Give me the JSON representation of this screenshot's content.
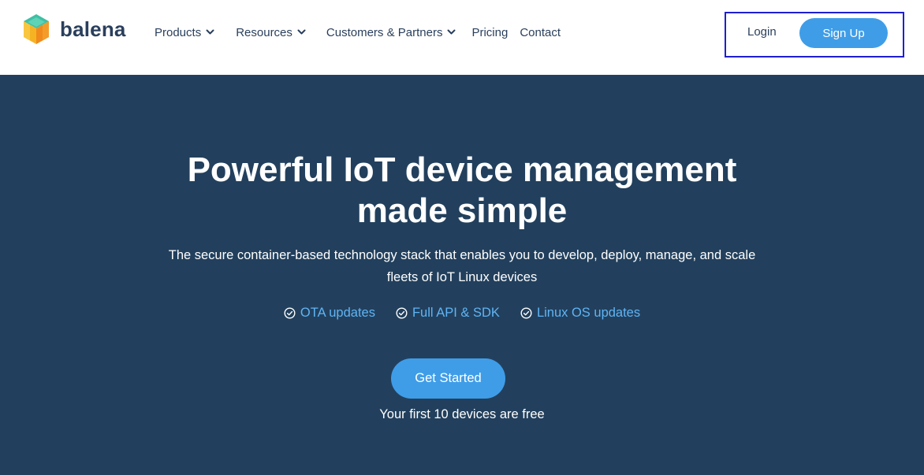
{
  "brand": {
    "name": "balena",
    "logo_icon": "balena-cube-icon"
  },
  "nav": {
    "items": [
      {
        "label": "Products",
        "has_dropdown": true
      },
      {
        "label": "Resources",
        "has_dropdown": true
      },
      {
        "label": "Customers & Partners",
        "has_dropdown": true
      },
      {
        "label": "Pricing",
        "has_dropdown": false
      },
      {
        "label": "Contact",
        "has_dropdown": false
      }
    ]
  },
  "auth": {
    "login_label": "Login",
    "signup_label": "Sign Up"
  },
  "hero": {
    "title_line1": "Powerful IoT device management",
    "title_line2": "made simple",
    "subtitle_line1": "The secure container-based technology stack that enables you to develop, deploy, manage, and scale",
    "subtitle_line2": "fleets of IoT Linux devices",
    "features": [
      {
        "label": "OTA updates",
        "icon": "check-circle-icon"
      },
      {
        "label": "Full API & SDK",
        "icon": "check-circle-icon"
      },
      {
        "label": "Linux OS updates",
        "icon": "check-circle-icon"
      }
    ],
    "cta_label": "Get Started",
    "cta_note": "Your first 10 devices are free"
  },
  "colors": {
    "header_bg": "#ffffff",
    "hero_bg": "#22405d",
    "primary_button": "#3f9de8",
    "feature_link": "#5fb4f5",
    "nav_text": "#2a3f5c",
    "highlight_border": "#1f1fd1"
  }
}
